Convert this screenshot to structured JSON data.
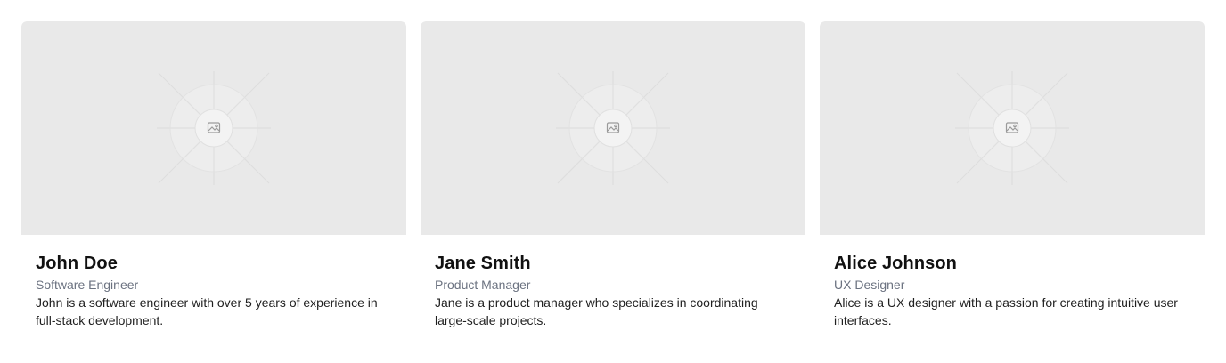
{
  "cards": [
    {
      "name": "John Doe",
      "role": "Software Engineer",
      "description": "John is a software engineer with over 5 years of experience in full-stack development.",
      "image_icon": "image-placeholder-icon"
    },
    {
      "name": "Jane Smith",
      "role": "Product Manager",
      "description": "Jane is a product manager who specializes in coordinating large-scale projects.",
      "image_icon": "image-placeholder-icon"
    },
    {
      "name": "Alice Johnson",
      "role": "UX Designer",
      "description": "Alice is a UX designer with a passion for creating intuitive user interfaces.",
      "image_icon": "image-placeholder-icon"
    }
  ],
  "colors": {
    "placeholder_bg": "#e9e9e9",
    "name": "#111111",
    "role": "#6b7280",
    "description": "#1f1f1f"
  }
}
